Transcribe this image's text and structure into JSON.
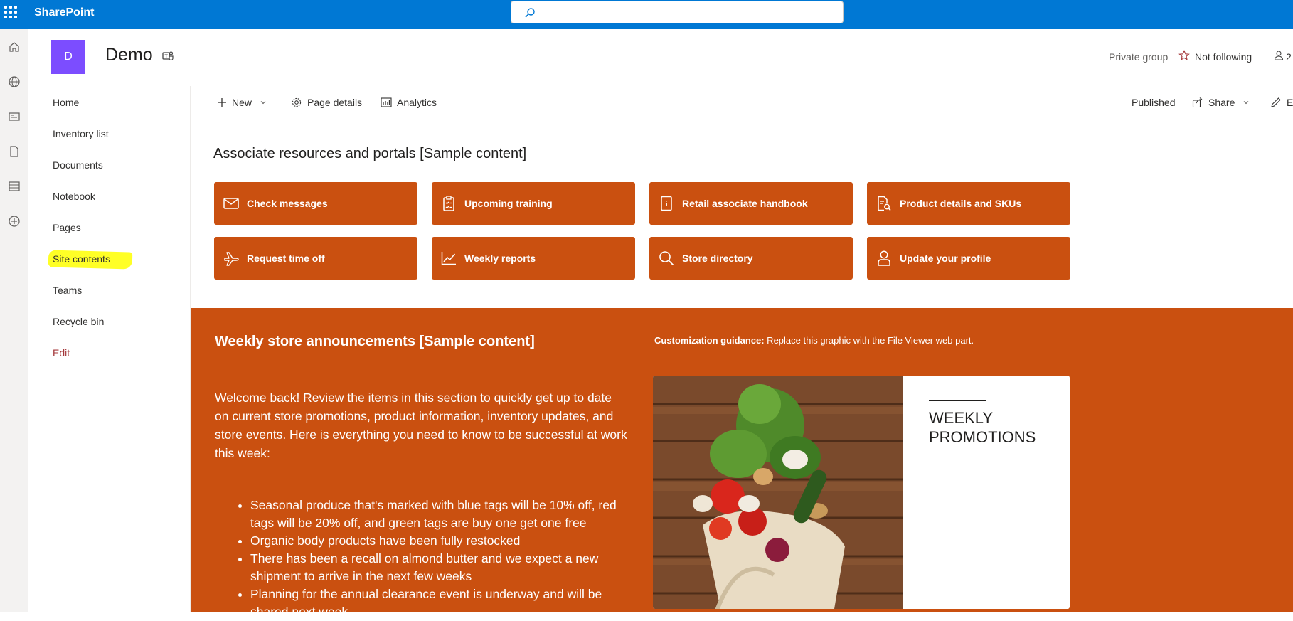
{
  "suite": {
    "brand": "SharePoint",
    "search_placeholder": ""
  },
  "site": {
    "logo_letter": "D",
    "title": "Demo",
    "privacy": "Private group",
    "follow_label": "Not following",
    "members_count": "2"
  },
  "nav": {
    "items": [
      {
        "label": "Home"
      },
      {
        "label": "Inventory list"
      },
      {
        "label": "Documents"
      },
      {
        "label": "Notebook"
      },
      {
        "label": "Pages"
      },
      {
        "label": "Site contents"
      },
      {
        "label": "Teams"
      },
      {
        "label": "Recycle bin"
      },
      {
        "label": "Edit"
      }
    ]
  },
  "commandbar": {
    "new_label": "New",
    "page_details_label": "Page details",
    "analytics_label": "Analytics",
    "status_label": "Published",
    "share_label": "Share",
    "edit_label": "E"
  },
  "quicklinks": {
    "title": "Associate resources and portals [Sample content]",
    "items": [
      {
        "label": "Check messages",
        "icon": "mail-icon"
      },
      {
        "label": "Upcoming training",
        "icon": "clipboard-icon"
      },
      {
        "label": "Retail associate handbook",
        "icon": "book-icon"
      },
      {
        "label": "Product details and SKUs",
        "icon": "document-search-icon"
      },
      {
        "label": "Request time off",
        "icon": "airplane-icon"
      },
      {
        "label": "Weekly reports",
        "icon": "chart-icon"
      },
      {
        "label": "Store directory",
        "icon": "search-icon"
      },
      {
        "label": "Update your profile",
        "icon": "person-icon"
      }
    ]
  },
  "announcements": {
    "title": "Weekly store announcements [Sample content]",
    "guidance_bold": "Customization guidance:",
    "guidance_text": " Replace this graphic with the File Viewer web part.",
    "intro": "Welcome back! Review the items in this section to quickly get up to date on current store promotions, product information, inventory updates, and store events. Here is everything you need to know to be successful at work this week:",
    "bullets": [
      "Seasonal produce that's marked with blue tags will be 10% off, red tags will be 20% off, and green tags are buy one get one free",
      "Organic body products have been fully restocked",
      "There has been a recall on almond butter and we expect a new shipment to arrive in the next few weeks",
      "Planning for the annual clearance event is underway and will be shared next week"
    ],
    "promo_line1": "WEEKLY",
    "promo_line2": "PROMOTIONS"
  },
  "colors": {
    "suitebar": "#0078d4",
    "accent": "#ca5010",
    "logo": "#7c4dff",
    "highlight": "#ffff26"
  }
}
